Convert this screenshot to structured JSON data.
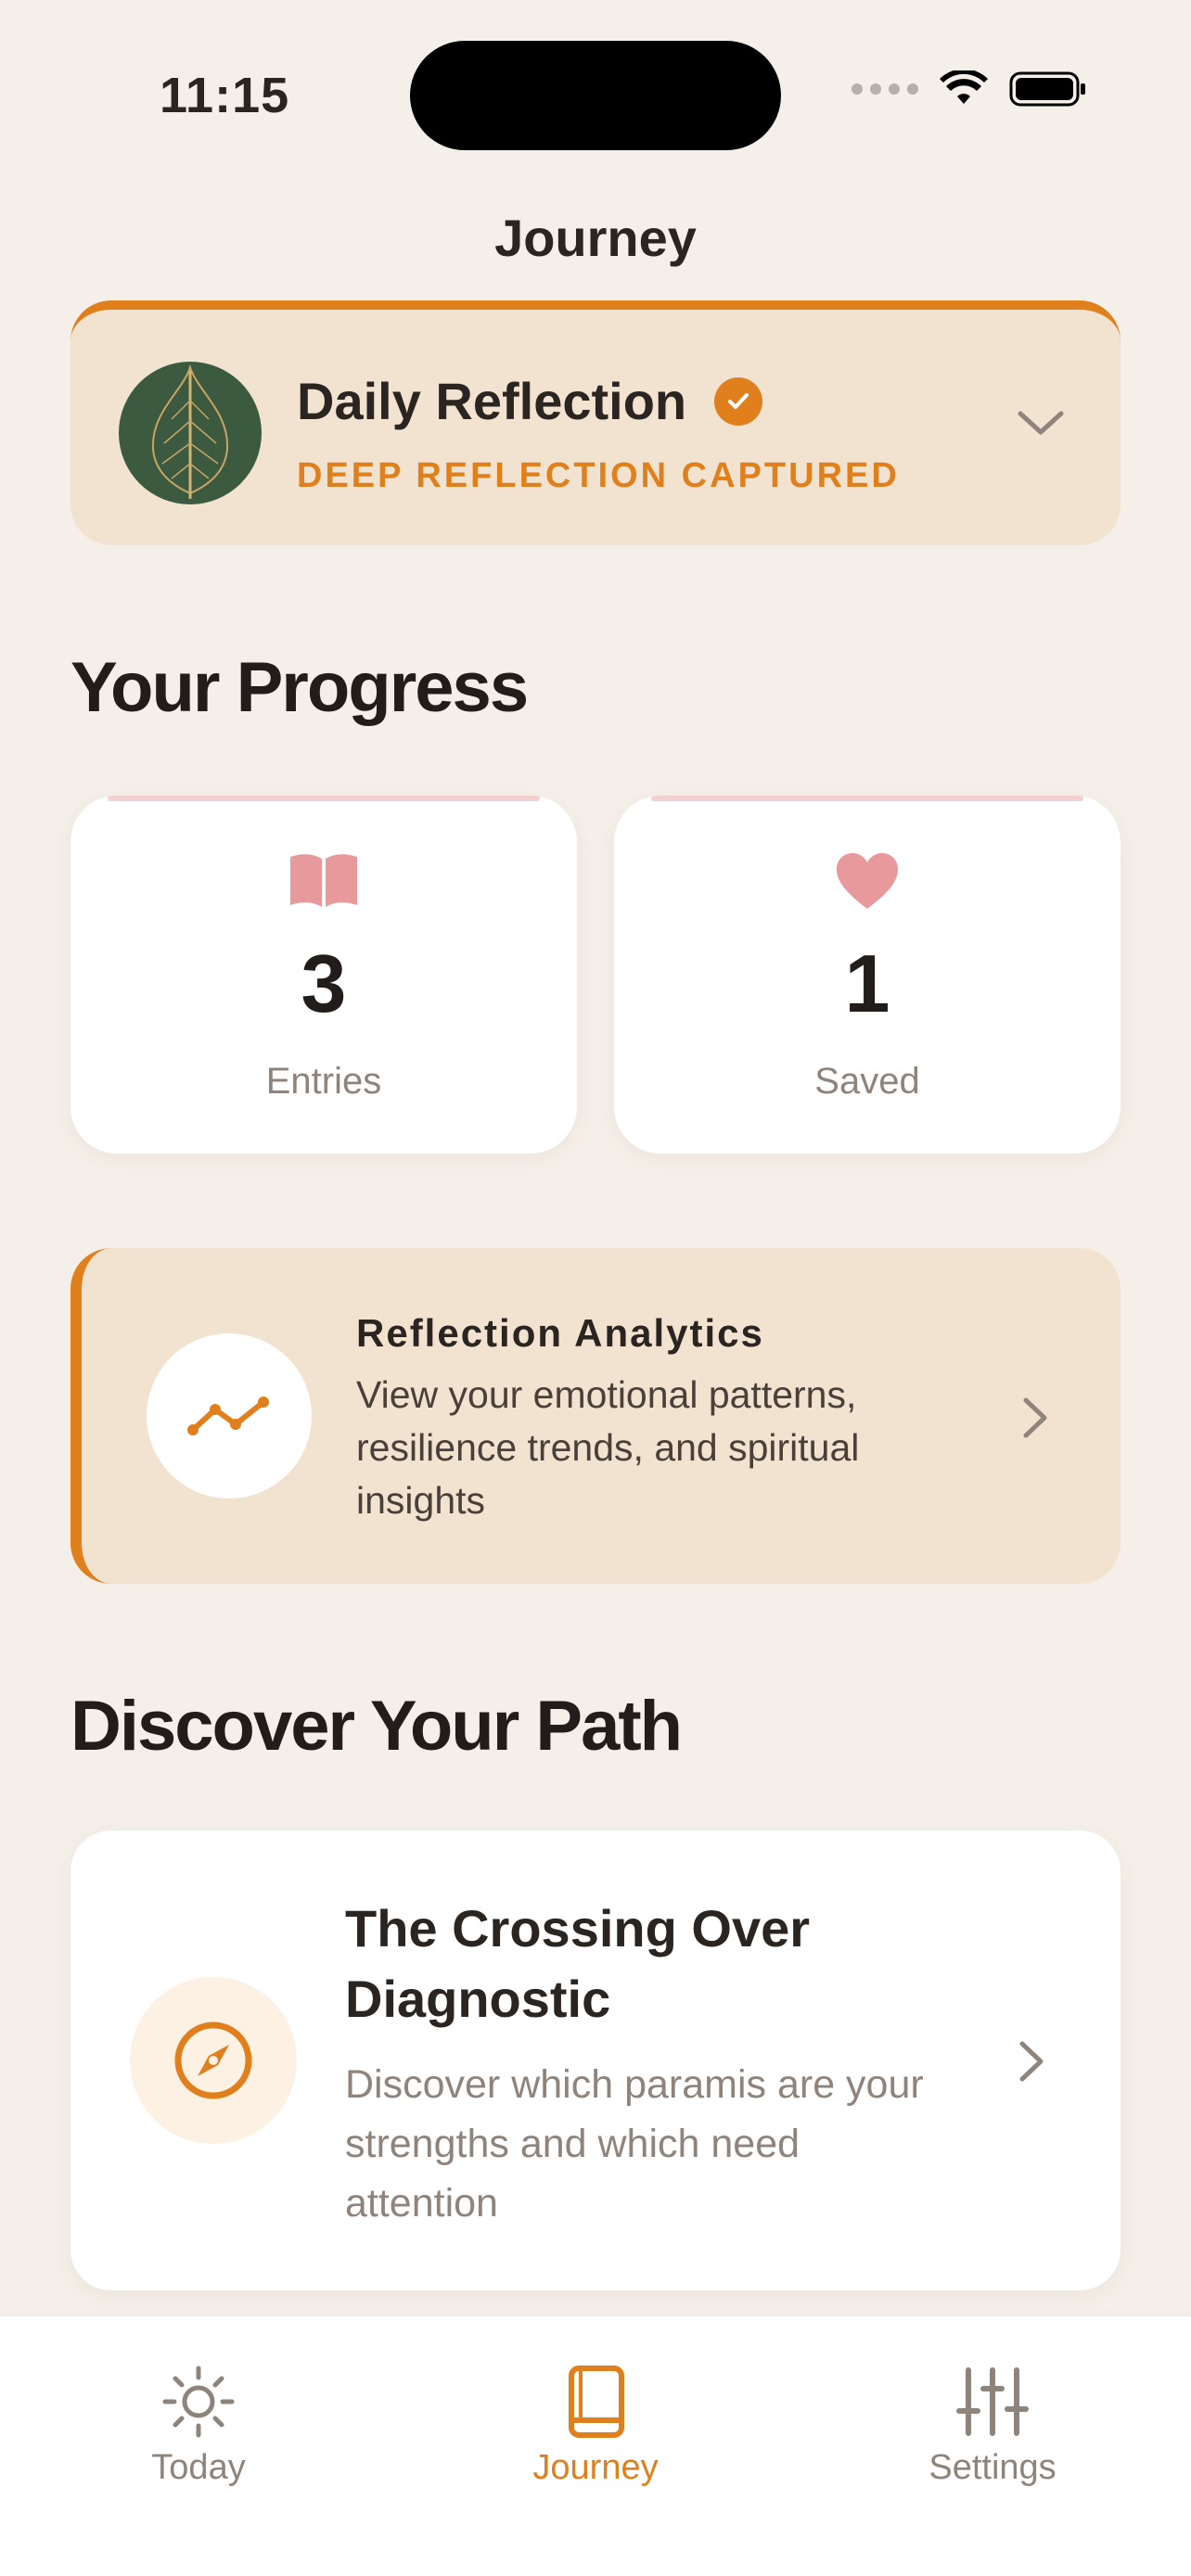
{
  "status": {
    "time": "11:15"
  },
  "nav": {
    "title": "Journey"
  },
  "daily": {
    "title": "Daily Reflection",
    "subtitle": "DEEP REFLECTION CAPTURED",
    "icon": "bodhi-leaf-icon"
  },
  "progress": {
    "title": "Your Progress",
    "stats": [
      {
        "value": "3",
        "label": "Entries",
        "icon": "book-icon"
      },
      {
        "value": "1",
        "label": "Saved",
        "icon": "heart-icon"
      }
    ]
  },
  "analytics": {
    "title": "Reflection Analytics",
    "description": "View your emotional patterns, resilience trends, and spiritual insights",
    "icon": "trend-line-icon"
  },
  "discover": {
    "title": "Discover Your Path",
    "card": {
      "title": "The Crossing Over Diagnostic",
      "description": "Discover which paramis are your strengths and which need attention",
      "icon": "compass-icon"
    }
  },
  "tabs": [
    {
      "label": "Today",
      "icon": "sun-icon",
      "active": false
    },
    {
      "label": "Journey",
      "icon": "book-icon",
      "active": true
    },
    {
      "label": "Settings",
      "icon": "sliders-icon",
      "active": false
    }
  ],
  "colors": {
    "accent": "#e0801d",
    "background": "#f4efe8",
    "card_tint": "#f2e2d0",
    "leaf_circle": "#3c5a40",
    "stat_icon": "#e8999b"
  }
}
